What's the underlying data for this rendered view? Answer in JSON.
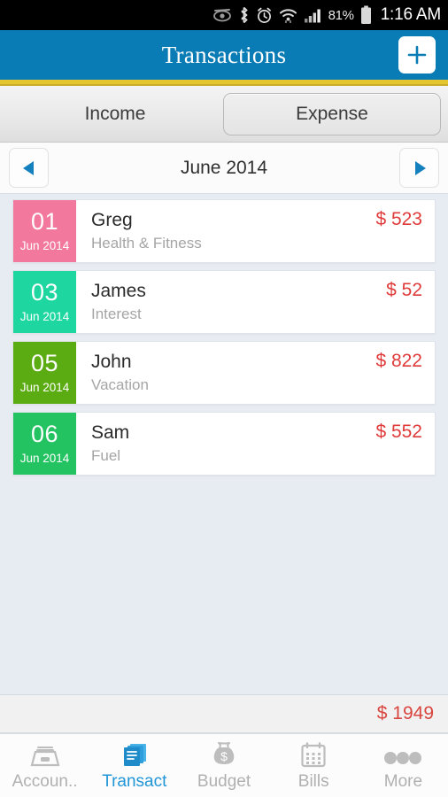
{
  "status_bar": {
    "icons": [
      "eye-slash-icon",
      "bluetooth-icon",
      "alarm-icon",
      "wifi-icon",
      "signal-icon"
    ],
    "battery_percent": "81%",
    "battery_icon": "battery-icon",
    "time": "1:16 AM"
  },
  "header": {
    "title": "Transactions",
    "add_label": "+",
    "bg_color": "#0a7cb5",
    "accent_rule_color": "#e5c62f"
  },
  "tabs": {
    "items": [
      {
        "label": "Income",
        "selected": false
      },
      {
        "label": "Expense",
        "selected": true
      }
    ]
  },
  "month_nav": {
    "prev_icon": "triangle-left-icon",
    "next_icon": "triangle-right-icon",
    "label": "June 2014"
  },
  "transactions": {
    "columns": [
      "date",
      "payee",
      "category",
      "amount"
    ],
    "rows": [
      {
        "day": "01",
        "month_year": "Jun 2014",
        "payee": "Greg",
        "category": "Health & Fitness",
        "amount": "$ 523",
        "color": "#f2799d"
      },
      {
        "day": "03",
        "month_year": "Jun 2014",
        "payee": "James",
        "category": "Interest",
        "amount": "$ 52",
        "color": "#1dd6a0"
      },
      {
        "day": "05",
        "month_year": "Jun 2014",
        "payee": "John",
        "category": "Vacation",
        "amount": "$ 822",
        "color": "#5bab12"
      },
      {
        "day": "06",
        "month_year": "Jun 2014",
        "payee": "Sam",
        "category": "Fuel",
        "amount": "$ 552",
        "color": "#23c361"
      }
    ]
  },
  "total": {
    "amount": "$ 1949",
    "color": "#d9453f"
  },
  "bottom_nav": {
    "items": [
      {
        "label": "Accoun..",
        "icon": "file-drawer-icon",
        "active": false
      },
      {
        "label": "Transact",
        "icon": "documents-stack-icon",
        "active": true
      },
      {
        "label": "Budget",
        "icon": "money-bag-icon",
        "active": false
      },
      {
        "label": "Bills",
        "icon": "calendar-icon",
        "active": false
      },
      {
        "label": "More",
        "icon": "three-dots-icon",
        "active": false
      }
    ],
    "active_color": "#2196d6",
    "inactive_color": "#b0b0b0"
  }
}
